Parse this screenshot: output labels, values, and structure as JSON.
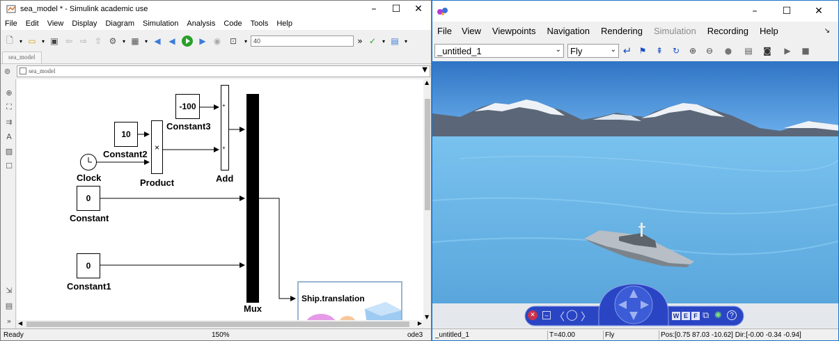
{
  "simulink": {
    "window_title": "sea_model * - Simulink academic use",
    "menu": [
      "File",
      "Edit",
      "View",
      "Display",
      "Diagram",
      "Simulation",
      "Analysis",
      "Code",
      "Tools",
      "Help"
    ],
    "stop_time": "40",
    "tab": "sea_model",
    "address": "sea_model",
    "blocks": {
      "constant3_value": "-100",
      "constant3_label": "Constant3",
      "constant2_value": "10",
      "constant2_label": "Constant2",
      "clock_label": "Clock",
      "product_sign": "×",
      "product_label": "Product",
      "add_label": "Add",
      "add_sign1": "+",
      "add_sign2": "+",
      "constant_value": "0",
      "constant_label": "Constant",
      "constant1_value": "0",
      "constant1_label": "Constant1",
      "mux_label": "Mux",
      "vr_label": "Ship.translation"
    },
    "status": {
      "left": "Ready",
      "zoom": "150%",
      "solver": "ode3"
    }
  },
  "vr": {
    "menu": [
      "File",
      "View",
      "Viewpoints",
      "Navigation",
      "Rendering",
      "Simulation",
      "Recording",
      "Help"
    ],
    "viewpoint_select": "_untitled_1",
    "nav_mode_select": "Fly",
    "nav_letters": [
      "W",
      "E",
      "F"
    ],
    "status": {
      "viewpoint": "_untitled_1",
      "time": "T=40.00",
      "mode": "Fly",
      "pos": "Pos:[0.75 87.03 -10.62] Dir:[-0.00 -0.34 -0.94]"
    },
    "colors": {
      "sky": "#3d86d6",
      "sea": "#5fb2e6",
      "nav_panel": "#2a45c4"
    }
  },
  "icons": {
    "sim_model_icon": "simulink-model-icon",
    "run": "run-icon",
    "vr_logo": "vr-logo-icon"
  }
}
